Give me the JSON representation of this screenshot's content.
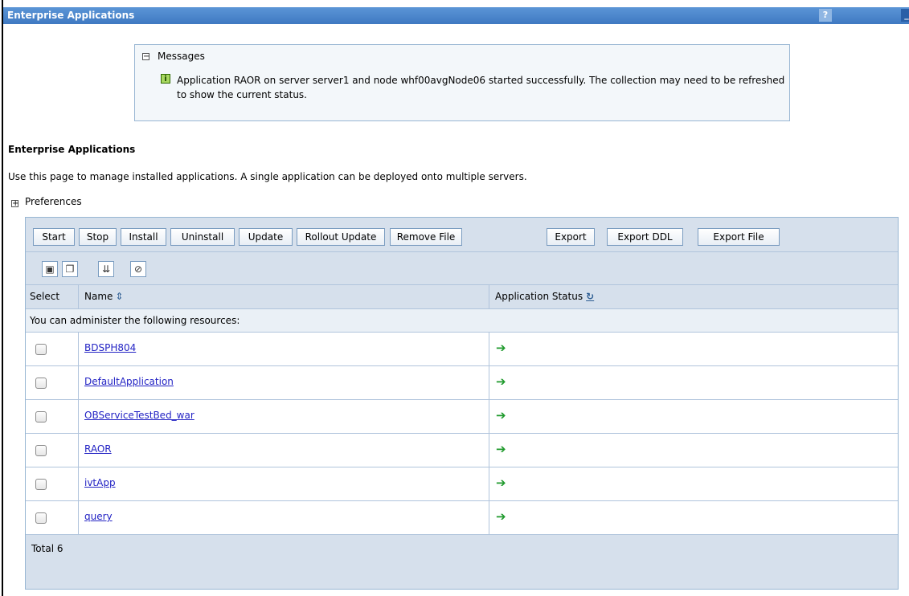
{
  "window": {
    "title": "Enterprise Applications",
    "help_glyph": "?",
    "minimize_glyph": "_"
  },
  "messages": {
    "toggle_glyph": "−",
    "title": "Messages",
    "info_glyph": "i",
    "text": "Application RAOR on server server1 and node whf00avgNode06 started successfully. The collection may need to be refreshed to show the current status."
  },
  "section": {
    "title": "Enterprise Applications",
    "description": "Use this page to manage installed applications. A single application can be deployed onto multiple servers."
  },
  "preferences": {
    "toggle_glyph": "+",
    "label": "Preferences"
  },
  "toolbar": {
    "buttons": [
      "Start",
      "Stop",
      "Install",
      "Uninstall",
      "Update",
      "Rollout Update",
      "Remove File",
      "Export",
      "Export DDL",
      "Export File"
    ]
  },
  "icon_toolbar": {
    "icons": [
      "select-all-icon",
      "deselect-all-icon",
      "show-filter-icon",
      "clear-filter-icon"
    ]
  },
  "table": {
    "headers": {
      "select": "Select",
      "name": "Name",
      "status": "Application Status"
    },
    "sort_glyph": "⇕",
    "refresh_glyph": "↻",
    "resources_note": "You can administer the following resources:",
    "rows": [
      {
        "name": "BDSPH804",
        "status": "started"
      },
      {
        "name": "DefaultApplication",
        "status": "started"
      },
      {
        "name": "OBServiceTestBed_war",
        "status": "started"
      },
      {
        "name": "RAOR",
        "status": "started"
      },
      {
        "name": "ivtApp",
        "status": "started"
      },
      {
        "name": "query",
        "status": "started"
      }
    ],
    "status_glyph": "➔",
    "total": "Total 6"
  },
  "colors": {
    "titlebar": "#4a86cc",
    "link": "#2323c4",
    "status_started": "#1f9a2c",
    "panel_bg": "#d6e0ec"
  }
}
